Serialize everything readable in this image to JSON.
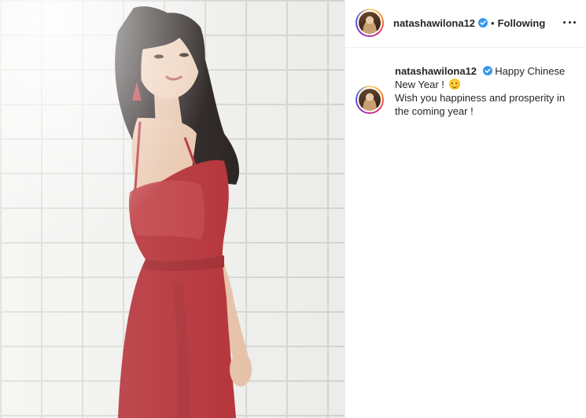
{
  "post": {
    "username": "natashawilona12",
    "separator": "•",
    "follow_state": "Following",
    "caption": {
      "line1": "Happy Chinese New Year !",
      "emoji": "smiling-face-with-hugging-hands",
      "line2": "Wish you happiness and prosperity in the coming year !"
    }
  },
  "icons": {
    "verified": "verified-badge-icon",
    "more": "more-options-icon"
  },
  "colors": {
    "verified_blue": "#3897f0",
    "dress_red": "#b3262c",
    "text": "#262626"
  }
}
